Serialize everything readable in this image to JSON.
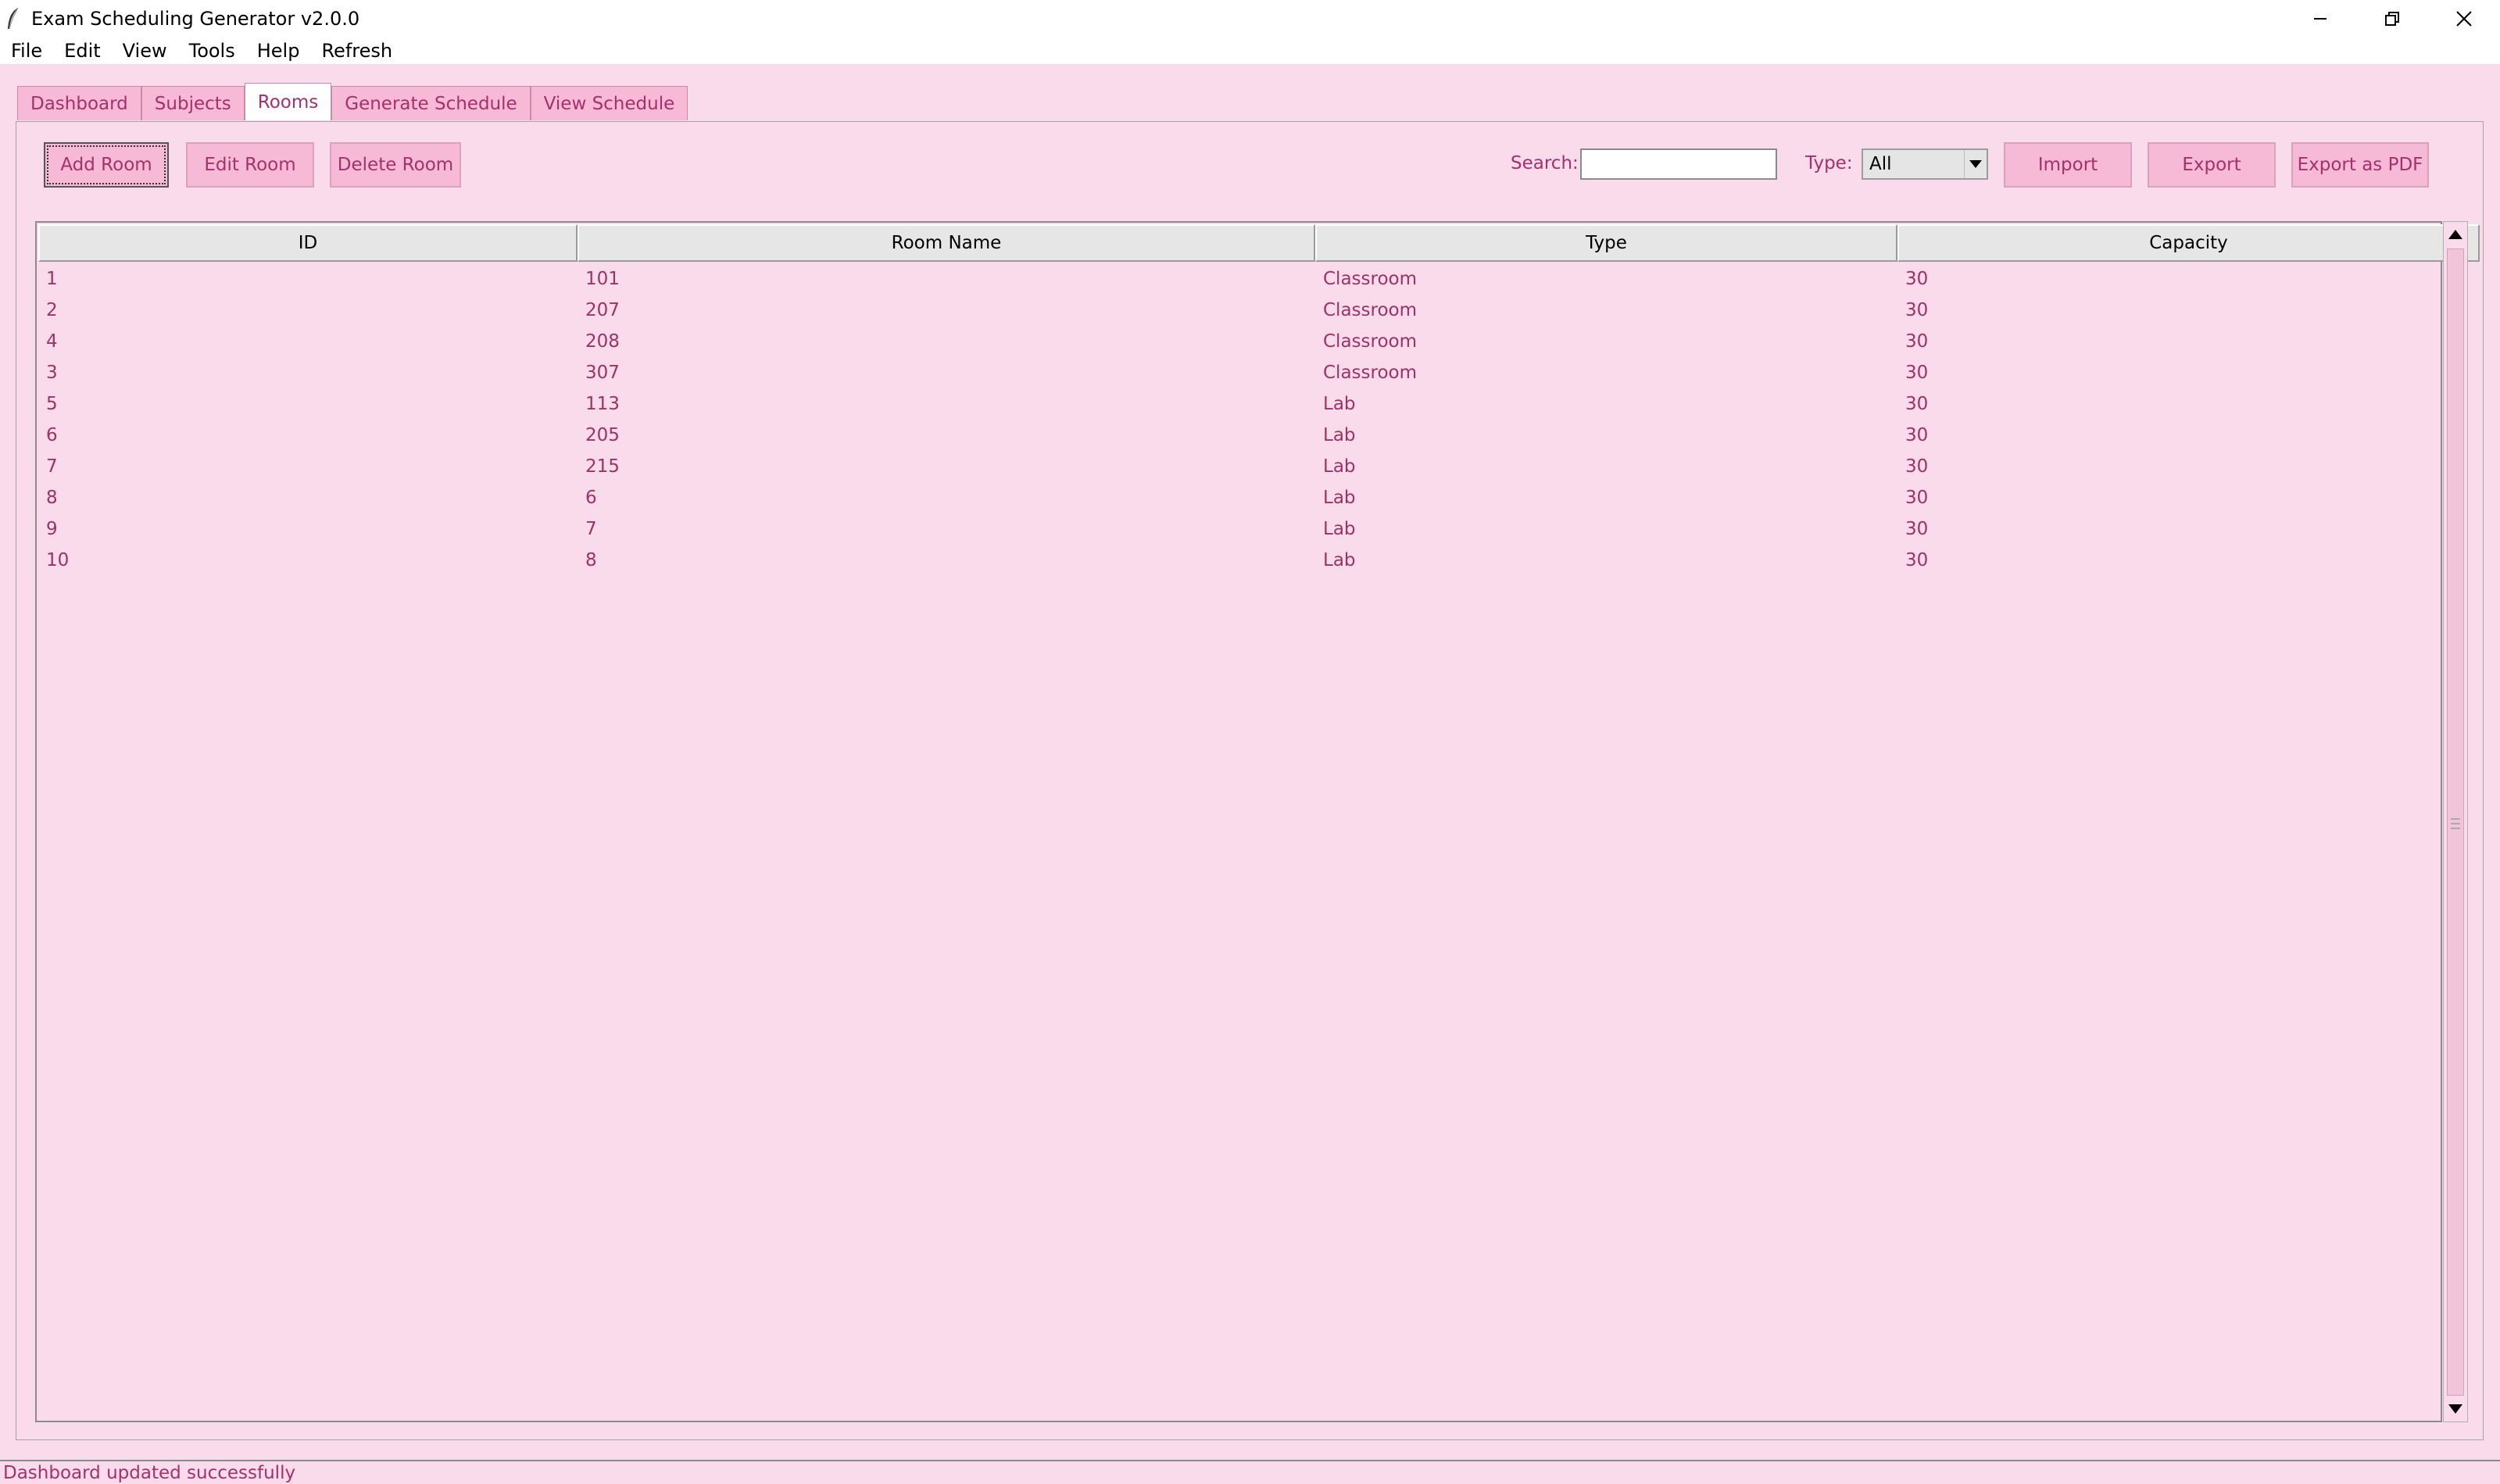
{
  "window": {
    "title": "Exam Scheduling Generator v2.0.0",
    "icon": "feather-icon"
  },
  "menu": [
    "File",
    "Edit",
    "View",
    "Tools",
    "Help",
    "Refresh"
  ],
  "tabs": [
    {
      "label": "Dashboard",
      "active": false
    },
    {
      "label": "Subjects",
      "active": false
    },
    {
      "label": "Rooms",
      "active": true
    },
    {
      "label": "Generate Schedule",
      "active": false
    },
    {
      "label": "View Schedule",
      "active": false
    }
  ],
  "toolbar": {
    "add_label": "Add Room",
    "edit_label": "Edit Room",
    "delete_label": "Delete Room",
    "search_label": "Search:",
    "search_value": "",
    "type_label": "Type:",
    "type_value": "All",
    "import_label": "Import",
    "export_label": "Export",
    "export_pdf_label": "Export as PDF"
  },
  "table": {
    "columns": [
      "ID",
      "Room Name",
      "Type",
      "Capacity"
    ],
    "rows": [
      [
        "1",
        "101",
        "Classroom",
        "30"
      ],
      [
        "2",
        "207",
        "Classroom",
        "30"
      ],
      [
        "4",
        "208",
        "Classroom",
        "30"
      ],
      [
        "3",
        "307",
        "Classroom",
        "30"
      ],
      [
        "5",
        "113",
        "Lab",
        "30"
      ],
      [
        "6",
        "205",
        "Lab",
        "30"
      ],
      [
        "7",
        "215",
        "Lab",
        "30"
      ],
      [
        "8",
        "6",
        "Lab",
        "30"
      ],
      [
        "9",
        "7",
        "Lab",
        "30"
      ],
      [
        "10",
        "8",
        "Lab",
        "30"
      ]
    ]
  },
  "status": "Dashboard updated successfully",
  "colors": {
    "background": "#fadbeb",
    "button": "#f6b9d6",
    "accent_text": "#a5306b"
  }
}
